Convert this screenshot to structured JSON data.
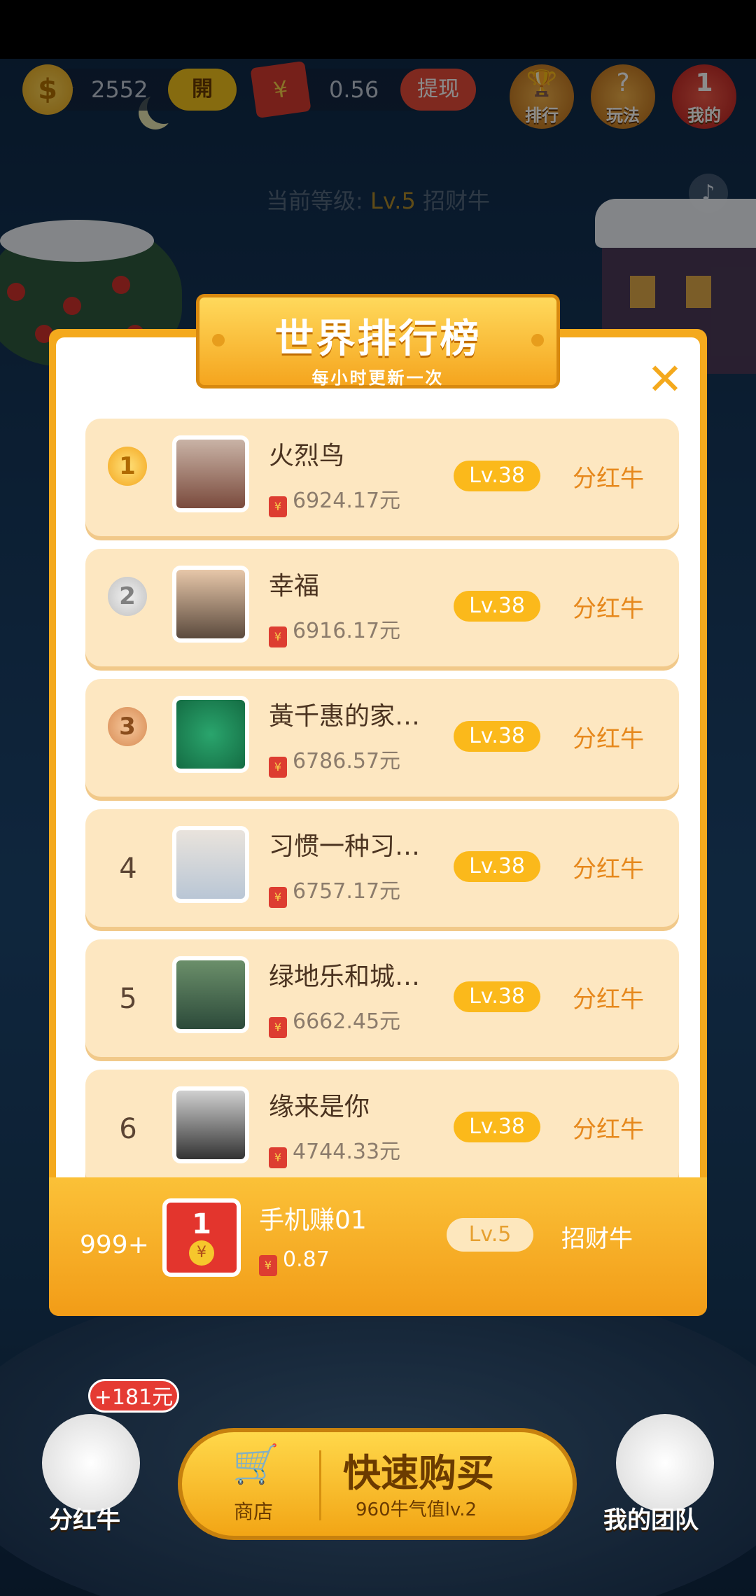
{
  "topbar": {
    "coin_value": "2552",
    "open_label": "開",
    "cash_value": "0.56",
    "withdraw_label": "提现",
    "rank_btn_label": "排行",
    "howto_btn_label": "玩法",
    "mine_btn_label": "我的",
    "mine_badge": "1"
  },
  "level_line": {
    "prefix": "当前等级:",
    "level": "Lv.5",
    "role": "招财牛"
  },
  "modal": {
    "title": "世界排行榜",
    "subtitle": "每小时更新一次",
    "rows": [
      {
        "rank": "1",
        "name": "火烈鸟",
        "money": "6924.17元",
        "level": "Lv.38",
        "role": "分红牛"
      },
      {
        "rank": "2",
        "name": "幸福",
        "money": "6916.17元",
        "level": "Lv.38",
        "role": "分红牛"
      },
      {
        "rank": "3",
        "name": "黃千惠的家…",
        "money": "6786.57元",
        "level": "Lv.38",
        "role": "分红牛"
      },
      {
        "rank": "4",
        "name": "习惯一种习…",
        "money": "6757.17元",
        "level": "Lv.38",
        "role": "分红牛"
      },
      {
        "rank": "5",
        "name": "绿地乐和城…",
        "money": "6662.45元",
        "level": "Lv.38",
        "role": "分红牛"
      },
      {
        "rank": "6",
        "name": "缘来是你",
        "money": "4744.33元",
        "level": "Lv.38",
        "role": "分红牛"
      }
    ],
    "me": {
      "rank": "999+",
      "avatar_num": "1",
      "name": "手机赚01",
      "money": "0.87",
      "level": "Lv.5",
      "role": "招财牛"
    }
  },
  "bottom": {
    "bonus": "+181元",
    "left_label": "分红牛",
    "shop_label": "商店",
    "buy_title": "快速购买",
    "buy_sub": "960牛气值lv.2",
    "right_label": "我的团队"
  },
  "colors": {
    "accent": "#f4a91d",
    "row_bg": "#fde7c1",
    "role_orange": "#e6881c"
  }
}
